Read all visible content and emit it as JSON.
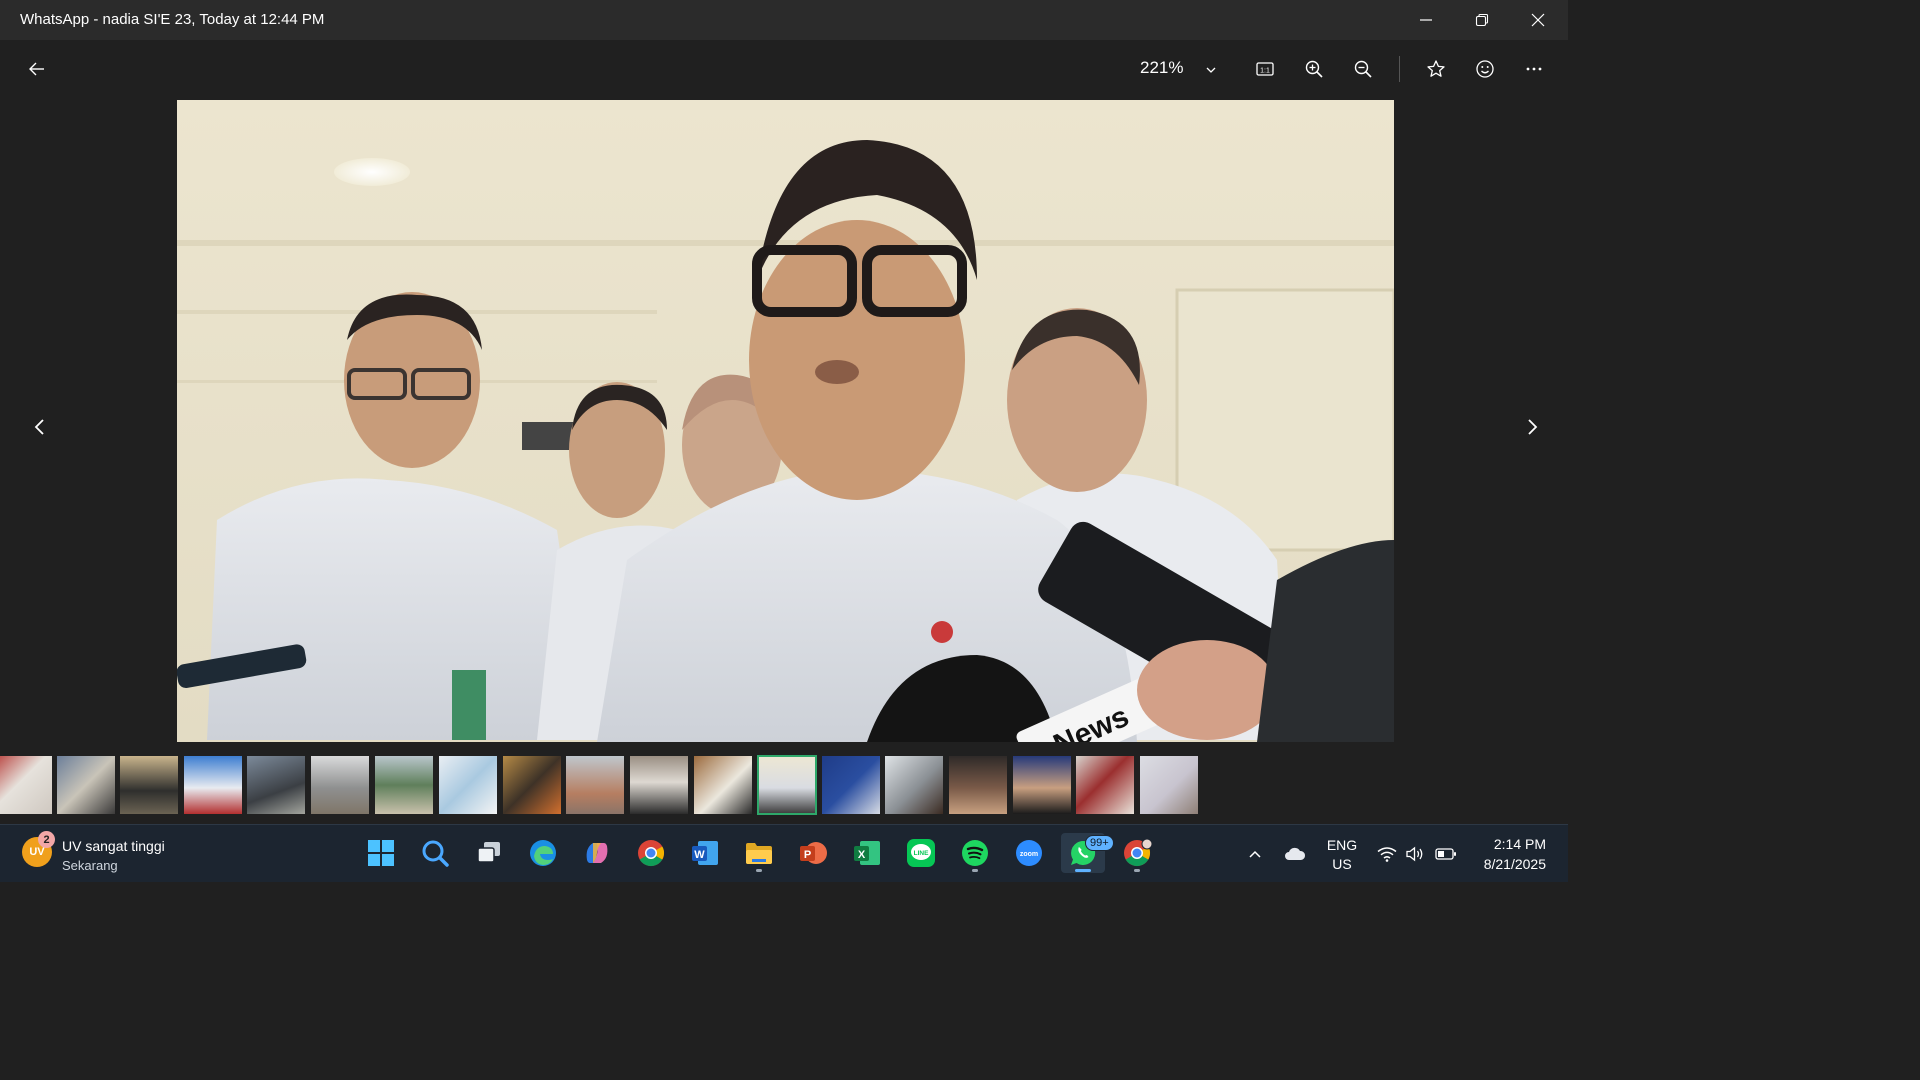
{
  "window": {
    "title": "WhatsApp - nadia SI'E 23, Today at 12:44 PM"
  },
  "toolbar": {
    "back_icon": "back-arrow-icon",
    "zoom_level": "221%",
    "icons": [
      "actual-size-icon",
      "zoom-in-icon",
      "zoom-out-icon",
      "star-icon",
      "smiley-icon",
      "more-icon"
    ]
  },
  "viewer": {
    "photo_overlay_text": "News",
    "prev_icon": "chevron-left-icon",
    "next_icon": "chevron-right-icon"
  },
  "filmstrip": {
    "thumbnail_count": 19,
    "selected_index": 12
  },
  "taskbar": {
    "notification": {
      "badge_label": "UV",
      "badge_count": "2",
      "title": "UV sangat tinggi",
      "subtitle": "Sekarang"
    },
    "apps": [
      {
        "name": "start-icon"
      },
      {
        "name": "search-icon"
      },
      {
        "name": "task-view-icon"
      },
      {
        "name": "edge-icon"
      },
      {
        "name": "copilot-icon"
      },
      {
        "name": "chrome-icon"
      },
      {
        "name": "word-icon",
        "label": "W"
      },
      {
        "name": "file-explorer-icon"
      },
      {
        "name": "powerpoint-icon",
        "label": "P"
      },
      {
        "name": "excel-icon",
        "label": "X"
      },
      {
        "name": "line-icon",
        "label": "LINE"
      },
      {
        "name": "spotify-icon"
      },
      {
        "name": "zoom-icon",
        "label": "zoom"
      },
      {
        "name": "whatsapp-icon",
        "badge": "99+"
      },
      {
        "name": "chrome-profile-icon"
      }
    ],
    "tray": {
      "lang_line1": "ENG",
      "lang_line2": "US",
      "time": "2:14 PM",
      "date": "8/21/2025"
    }
  },
  "colors": {
    "titlebar": "#2b2b2b",
    "viewer_bg": "#202020",
    "taskbar": "#1c2530",
    "selected_thumb": "#2ea86a",
    "accent": "#5fb2ff"
  }
}
